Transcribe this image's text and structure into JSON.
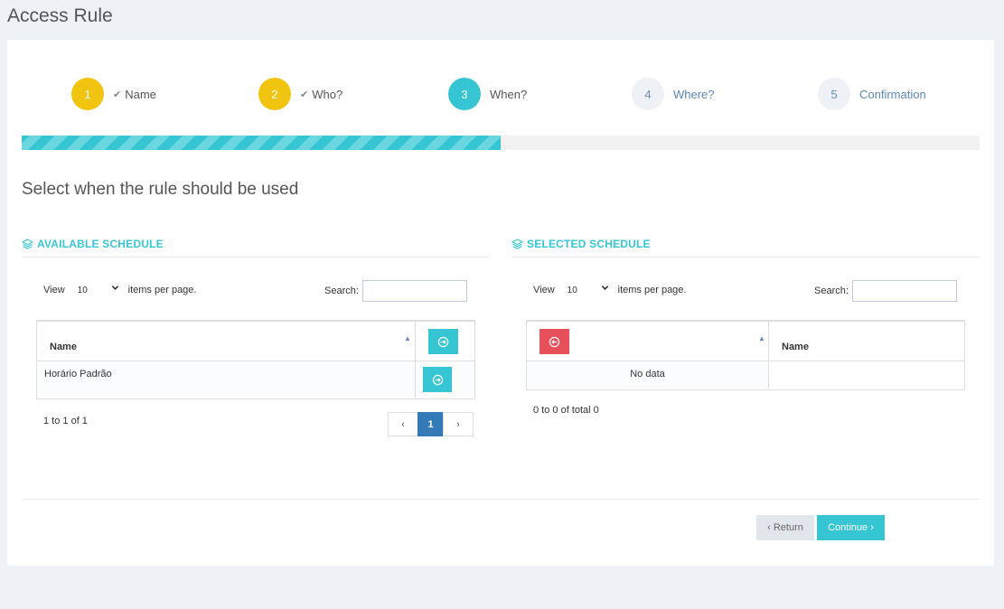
{
  "page": {
    "title": "Access Rule"
  },
  "steps": [
    {
      "number": "1",
      "label": "Name",
      "state": "done"
    },
    {
      "number": "2",
      "label": "Who?",
      "state": "done"
    },
    {
      "number": "3",
      "label": "When?",
      "state": "active"
    },
    {
      "number": "4",
      "label": "Where?",
      "state": "todo"
    },
    {
      "number": "5",
      "label": "Confirmation",
      "state": "todo"
    }
  ],
  "progress": {
    "percent": 50
  },
  "subtitle": "Select when the rule should be used",
  "available": {
    "heading": "AVAILABLE SCHEDULE",
    "view_label": "View",
    "page_size": "10",
    "per_page_label": "items per page.",
    "search_label": "Search:",
    "search_value": "",
    "column_name": "Name",
    "rows": [
      {
        "name": "Horário Padrão"
      }
    ],
    "summary": "1 to 1 of 1",
    "pager": {
      "prev": "‹",
      "current": "1",
      "next": "›"
    }
  },
  "selected": {
    "heading": "SELECTED SCHEDULE",
    "view_label": "View",
    "page_size": "10",
    "per_page_label": "items per page.",
    "search_label": "Search:",
    "search_value": "",
    "column_name": "Name",
    "empty_text": "No data",
    "summary": "0 to 0 of total 0"
  },
  "actions": {
    "return_label": "‹ Return",
    "continue_label": "Continue ›"
  },
  "colors": {
    "done": "#f1c40f",
    "active": "#36c6d3",
    "accent": "#36c6d3",
    "danger": "#e7505a",
    "pager_active": "#337ab7"
  },
  "icons": {
    "check": "check-icon",
    "layers": "layers-icon",
    "add": "arrow-circle-right-icon",
    "remove": "arrow-circle-left-icon",
    "sort": "sort-up-icon",
    "select_chevron": "chevron-down-icon"
  }
}
